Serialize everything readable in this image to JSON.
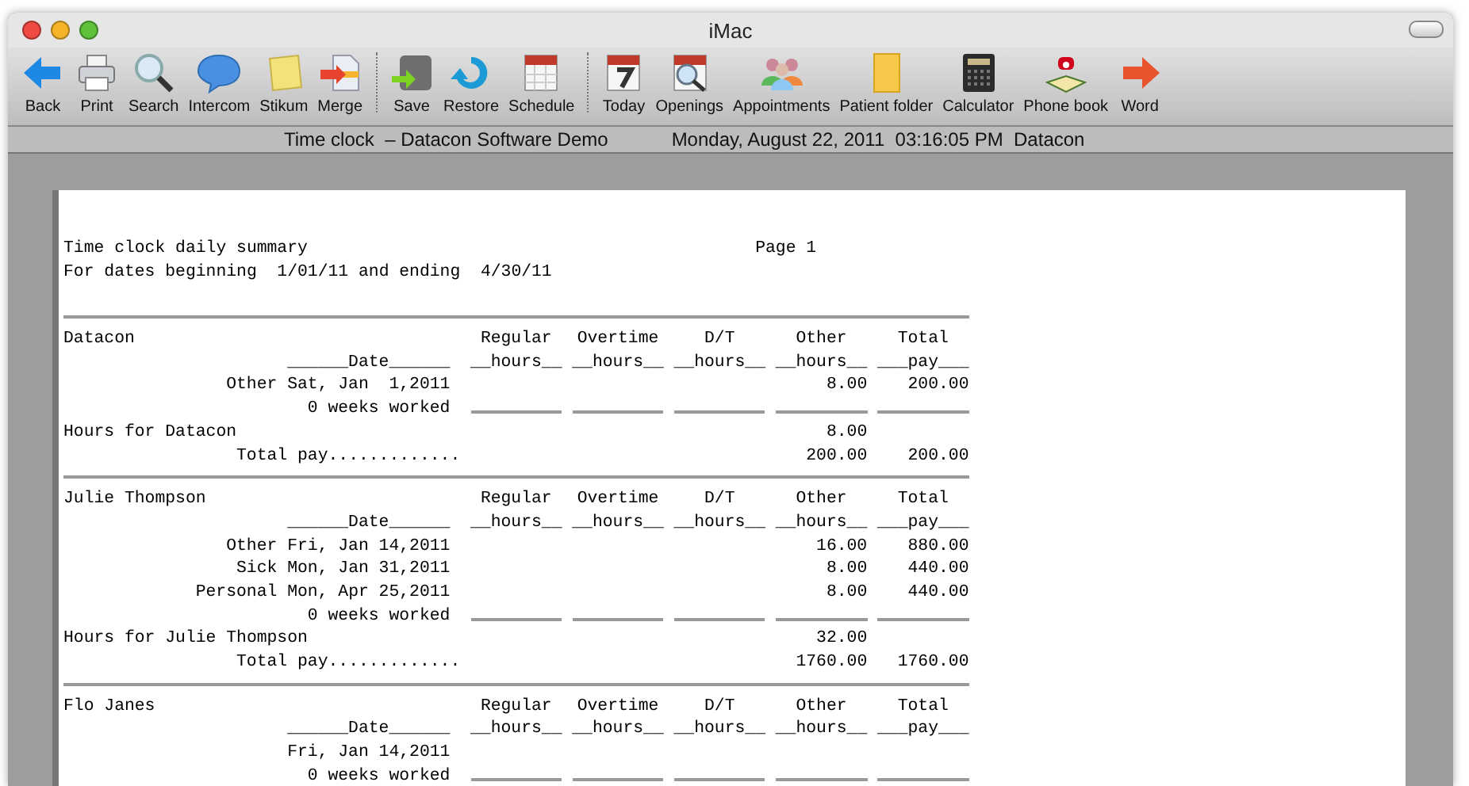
{
  "window": {
    "title": "iMac"
  },
  "toolbar_groups": [
    {
      "items": [
        {
          "label": "Back"
        },
        {
          "label": "Print"
        },
        {
          "label": "Search"
        },
        {
          "label": "Intercom"
        },
        {
          "label": "Stikum"
        },
        {
          "label": "Merge"
        }
      ]
    },
    {
      "items": [
        {
          "label": "Save"
        },
        {
          "label": "Restore"
        },
        {
          "label": "Schedule"
        }
      ]
    },
    {
      "items": [
        {
          "label": "Today"
        },
        {
          "label": "Openings"
        },
        {
          "label": "Appointments"
        },
        {
          "label": "Patient folder"
        },
        {
          "label": "Calculator"
        },
        {
          "label": "Phone book"
        },
        {
          "label": "Word"
        }
      ]
    }
  ],
  "status_bar": {
    "title": "Time clock  – Datacon Software Demo",
    "datetime": "Monday, August 22, 2011  03:16:05 PM  Datacon"
  },
  "report": {
    "title": "Time clock daily summary",
    "page": "Page 1",
    "range": "For dates beginning  1/01/11 and ending  4/30/11",
    "sections": [
      {
        "name": "Datacon",
        "date_header": "______Date______",
        "columns": [
          {
            "top": "Regular",
            "bottom": "__hours__"
          },
          {
            "top": "Overtime",
            "bottom": "__hours__"
          },
          {
            "top": "D/T",
            "bottom": "__hours__"
          },
          {
            "top": "Other",
            "bottom": "__hours__"
          },
          {
            "top": "Total",
            "bottom": "___pay___"
          }
        ],
        "entries": [
          {
            "label": "Other Sat, Jan  1,2011",
            "other_hours": "8.00",
            "total_pay": "200.00"
          }
        ],
        "weeks": "0 weeks worked",
        "hours_label": "Hours for Datacon",
        "hours_other": "8.00",
        "total_label": "Total pay.............",
        "total_other": "200.00",
        "total_pay": "200.00"
      },
      {
        "name": "Julie Thompson",
        "date_header": "______Date______",
        "columns": [
          {
            "top": "Regular",
            "bottom": "__hours__"
          },
          {
            "top": "Overtime",
            "bottom": "__hours__"
          },
          {
            "top": "D/T",
            "bottom": "__hours__"
          },
          {
            "top": "Other",
            "bottom": "__hours__"
          },
          {
            "top": "Total",
            "bottom": "___pay___"
          }
        ],
        "entries": [
          {
            "label": "Other Fri, Jan 14,2011",
            "other_hours": "16.00",
            "total_pay": "880.00"
          },
          {
            "label": "Sick Mon, Jan 31,2011",
            "other_hours": "8.00",
            "total_pay": "440.00"
          },
          {
            "label": "Personal Mon, Apr 25,2011",
            "other_hours": "8.00",
            "total_pay": "440.00"
          }
        ],
        "weeks": "0 weeks worked",
        "hours_label": "Hours for Julie Thompson",
        "hours_other": "32.00",
        "total_label": "Total pay.............",
        "total_other": "1760.00",
        "total_pay": "1760.00"
      },
      {
        "name": "Flo Janes",
        "date_header": "______Date______",
        "columns": [
          {
            "top": "Regular",
            "bottom": "__hours__"
          },
          {
            "top": "Overtime",
            "bottom": "__hours__"
          },
          {
            "top": "D/T",
            "bottom": "__hours__"
          },
          {
            "top": "Other",
            "bottom": "__hours__"
          },
          {
            "top": "Total",
            "bottom": "___pay___"
          }
        ],
        "entries": [
          {
            "label": "Fri, Jan 14,2011"
          }
        ],
        "weeks": "0 weeks worked"
      }
    ]
  }
}
